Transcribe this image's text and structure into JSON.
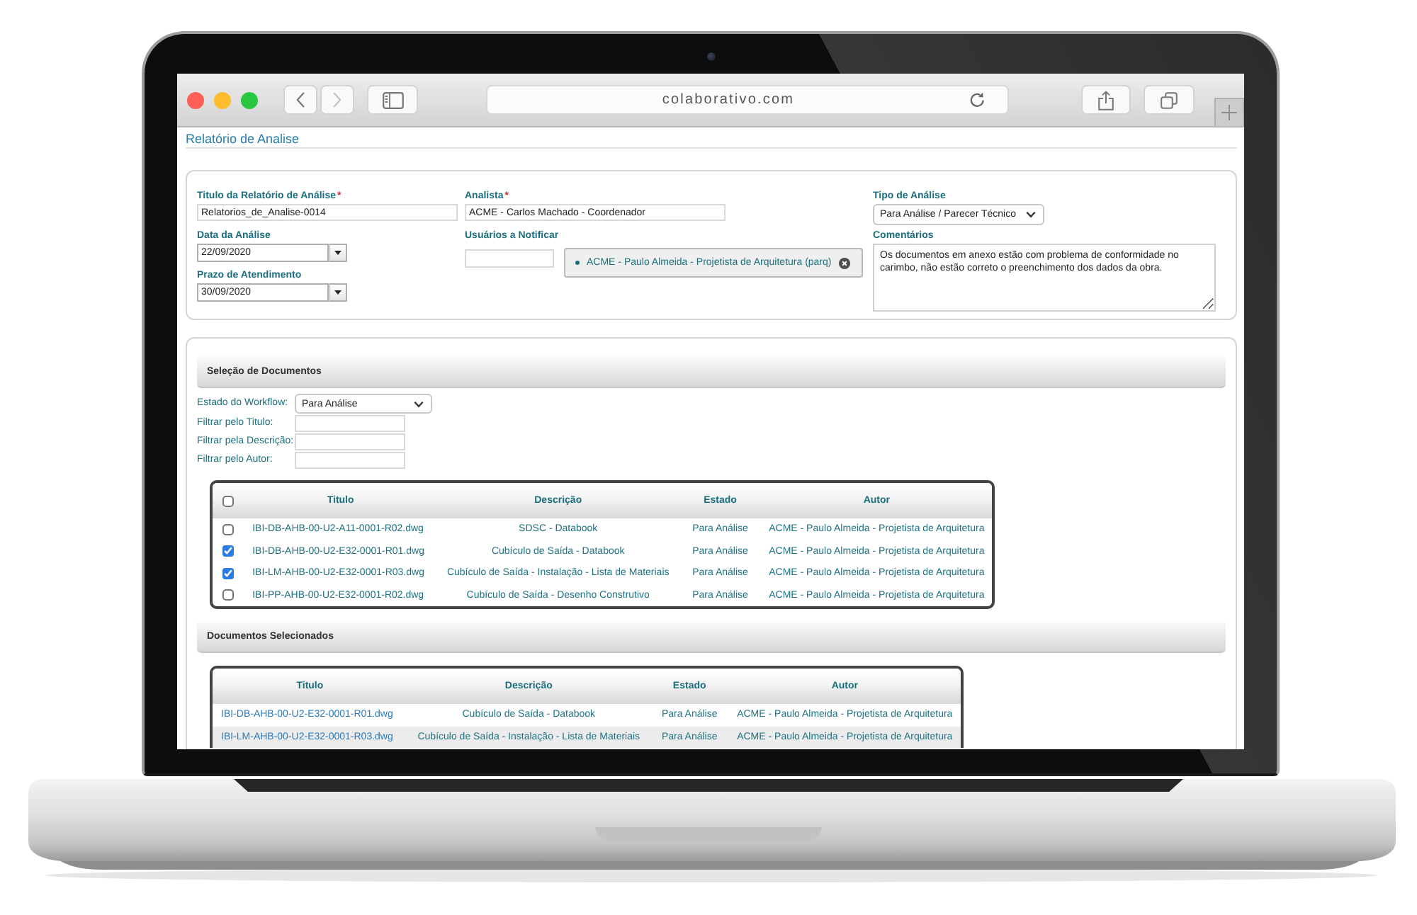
{
  "browser": {
    "url": "colaborativo.com",
    "back": {
      "disabled": false
    },
    "forward": {
      "disabled": true
    }
  },
  "page": {
    "title": "Relatório de Analise"
  },
  "report_form": {
    "columns": [
      {
        "fields": [
          {
            "kind": "text",
            "label": "Titulo da Relatório de Análise",
            "required_mark": "*",
            "value": "Relatorios_de_Analise-0014"
          },
          {
            "kind": "date",
            "label": "Data da Análise",
            "value": "22/09/2020"
          },
          {
            "kind": "date",
            "label": "Prazo de Atendimento",
            "value": "30/09/2020"
          }
        ]
      },
      {
        "fields": [
          {
            "kind": "text",
            "label": "Analista",
            "required_mark": "*",
            "value": "ACME - Carlos Machado - Coordenador"
          },
          {
            "kind": "tags",
            "label": "Usuários a Notificar",
            "tags": [
              "ACME - Paulo Almeida - Projetista de Arquitetura (parq)"
            ]
          }
        ]
      },
      {
        "fields": [
          {
            "kind": "select",
            "label": "Tipo de Análise",
            "value": "Para Análise / Parecer Técnico"
          },
          {
            "kind": "textarea",
            "label": "Comentários",
            "value": "Os documentos em anexo estão com problema de conformidade no carimbo, não estão correto o preenchimento dos dados da obra."
          }
        ]
      }
    ]
  },
  "document_selection": {
    "heading": "Seleção de Documentos",
    "filters": [
      {
        "kind": "select",
        "label": "Estado do Workflow:",
        "value": "Para Análise"
      },
      {
        "kind": "text",
        "label": "Filtrar pelo Titulo:"
      },
      {
        "kind": "text",
        "label": "Filtrar pela Descrição:"
      },
      {
        "kind": "text",
        "label": "Filtrar pelo Autor:"
      }
    ],
    "table": {
      "select_all_checked": false,
      "columns": [
        "Titulo",
        "Descrição",
        "Estado",
        "Autor"
      ],
      "rows": [
        {
          "checked": false,
          "cells": [
            "IBI-DB-AHB-00-U2-A11-0001-R02.dwg",
            "SDSC - Databook",
            "Para Análise",
            "ACME - Paulo Almeida - Projetista de Arquitetura"
          ]
        },
        {
          "checked": true,
          "cells": [
            "IBI-DB-AHB-00-U2-E32-0001-R01.dwg",
            "Cubículo de Saída - Databook",
            "Para Análise",
            "ACME - Paulo Almeida - Projetista de Arquitetura"
          ]
        },
        {
          "checked": true,
          "cells": [
            "IBI-LM-AHB-00-U2-E32-0001-R03.dwg",
            "Cubículo de Saída - Instalação - Lista de Materiais",
            "Para Análise",
            "ACME - Paulo Almeida - Projetista de Arquitetura"
          ]
        },
        {
          "checked": false,
          "cells": [
            "IBI-PP-AHB-00-U2-E32-0001-R02.dwg",
            "Cubículo de Saída - Desenho Construtivo",
            "Para Análise",
            "ACME - Paulo Almeida - Projetista de Arquitetura"
          ]
        }
      ]
    }
  },
  "selected_documents": {
    "heading": "Documentos Selecionados",
    "table": {
      "columns": [
        "Titulo",
        "Descrição",
        "Estado",
        "Autor"
      ],
      "rows": [
        [
          "IBI-DB-AHB-00-U2-E32-0001-R01.dwg",
          "Cubículo de Saída - Databook",
          "Para Análise",
          "ACME - Paulo Almeida - Projetista de Arquitetura"
        ],
        [
          "IBI-LM-AHB-00-U2-E32-0001-R03.dwg",
          "Cubículo de Saída - Instalação - Lista de Materiais",
          "Para Análise",
          "ACME - Paulo Almeida - Projetista de Arquitetura"
        ]
      ]
    }
  }
}
